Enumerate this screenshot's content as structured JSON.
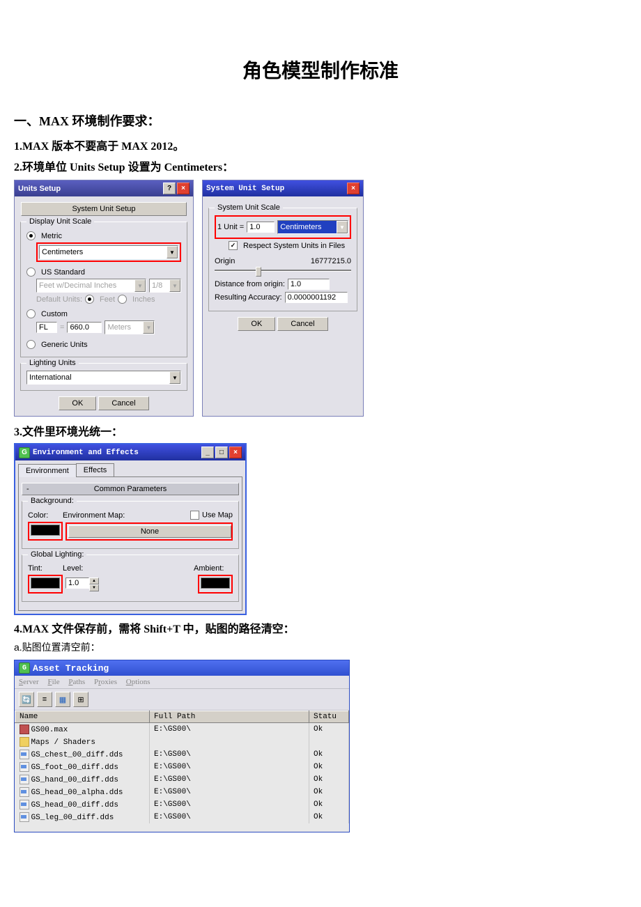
{
  "doc_title": "角色模型制作标准",
  "section1": {
    "heading": "一、MAX 环境制作要求：",
    "item1": "1.MAX 版本不要高于 MAX 2012。",
    "item2": "2.环境单位 Units Setup 设置为 Centimeters：",
    "item3": "3.文件里环境光统一：",
    "item4": "4.MAX 文件保存前，需将 Shift+T 中，贴图的路径清空：",
    "item4a": "a.贴图位置清空前："
  },
  "units_dlg": {
    "title": "Units Setup",
    "top_btn": "System Unit Setup",
    "grp_display": "Display Unit Scale",
    "opt_metric": "Metric",
    "metric_val": "Centimeters",
    "opt_us": "US Standard",
    "us_val": "Feet w/Decimal Inches",
    "us_frac": "1/8",
    "def_units": "Default Units:",
    "def_feet": "Feet",
    "def_inches": "Inches",
    "opt_custom": "Custom",
    "custom_unit": "FL",
    "custom_eq": "=",
    "custom_val": "660.0",
    "custom_meters": "Meters",
    "opt_generic": "Generic Units",
    "grp_lighting": "Lighting Units",
    "lighting_val": "International",
    "ok": "OK",
    "cancel": "Cancel"
  },
  "sys_dlg": {
    "title": "System Unit Setup",
    "grp": "System Unit Scale",
    "unit_lbl": "1 Unit =",
    "unit_val": "1.0",
    "unit_cm": "Centimeters",
    "respect": "Respect System Units in Files",
    "origin": "Origin",
    "origin_val": "16777215.0",
    "dist": "Distance from origin:",
    "dist_val": "1.0",
    "acc": "Resulting Accuracy:",
    "acc_val": "0.0000001192",
    "ok": "OK",
    "cancel": "Cancel"
  },
  "env_dlg": {
    "title": "Environment and Effects",
    "tab_env": "Environment",
    "tab_eff": "Effects",
    "rollout": "Common Parameters",
    "grp_bg": "Background:",
    "color": "Color:",
    "env_map": "Environment Map:",
    "use_map": "Use Map",
    "none": "None",
    "grp_gl": "Global Lighting:",
    "tint": "Tint:",
    "level": "Level:",
    "level_val": "1.0",
    "ambient": "Ambient:"
  },
  "at": {
    "title": "Asset Tracking",
    "menu": {
      "server": "Server",
      "file": "File",
      "paths": "Paths",
      "proxies": "Proxies",
      "options": "Options"
    },
    "cols": {
      "name": "Name",
      "full": "Full Path",
      "status": "Statu"
    },
    "rows": [
      {
        "icon": "max",
        "name": "GS00.max",
        "path": "E:\\GS00\\",
        "status": "Ok",
        "indent": 0
      },
      {
        "icon": "fold",
        "name": "Maps / Shaders",
        "path": "",
        "status": "",
        "indent": 1
      },
      {
        "icon": "dds",
        "name": "GS_chest_00_diff.dds",
        "path": "E:\\GS00\\",
        "status": "Ok",
        "indent": 2
      },
      {
        "icon": "dds",
        "name": "GS_foot_00_diff.dds",
        "path": "E:\\GS00\\",
        "status": "Ok",
        "indent": 2
      },
      {
        "icon": "dds",
        "name": "GS_hand_00_diff.dds",
        "path": "E:\\GS00\\",
        "status": "Ok",
        "indent": 2
      },
      {
        "icon": "dds",
        "name": "GS_head_00_alpha.dds",
        "path": "E:\\GS00\\",
        "status": "Ok",
        "indent": 2
      },
      {
        "icon": "dds",
        "name": "GS_head_00_diff.dds",
        "path": "E:\\GS00\\",
        "status": "Ok",
        "indent": 2
      },
      {
        "icon": "dds",
        "name": "GS_leg_00_diff.dds",
        "path": "E:\\GS00\\",
        "status": "Ok",
        "indent": 2
      }
    ]
  }
}
